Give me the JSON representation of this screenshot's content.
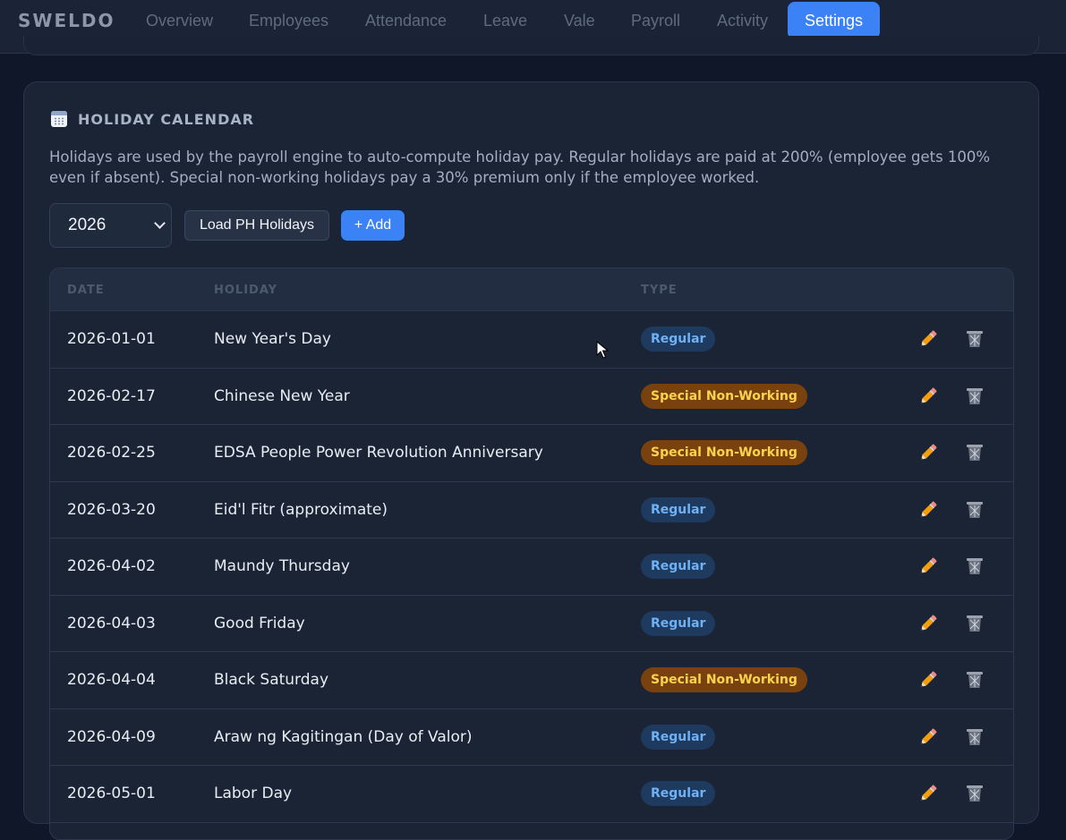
{
  "app": {
    "brand": "SWELDO"
  },
  "nav": {
    "tabs": [
      {
        "label": "Overview"
      },
      {
        "label": "Employees"
      },
      {
        "label": "Attendance"
      },
      {
        "label": "Leave"
      },
      {
        "label": "Vale"
      },
      {
        "label": "Payroll"
      },
      {
        "label": "Activity"
      },
      {
        "label": "Settings",
        "active": true
      }
    ]
  },
  "holiday_card": {
    "title": "HOLIDAY CALENDAR",
    "icon": "calendar-icon",
    "description": "Holidays are used by the payroll engine to auto-compute holiday pay. Regular holidays are paid at 200% (employee gets 100% even if absent). Special non-working holidays pay a 30% premium only if the employee worked.",
    "year_select": {
      "value": "2026"
    },
    "load_button": "Load PH Holidays",
    "add_button": "+ Add",
    "table": {
      "headers": {
        "date": "DATE",
        "holiday": "HOLIDAY",
        "type": "TYPE"
      },
      "rows": [
        {
          "date": "2026-01-01",
          "name": "New Year's Day",
          "type": "Regular"
        },
        {
          "date": "2026-02-17",
          "name": "Chinese New Year",
          "type": "Special Non-Working"
        },
        {
          "date": "2026-02-25",
          "name": "EDSA People Power Revolution Anniversary",
          "type": "Special Non-Working"
        },
        {
          "date": "2026-03-20",
          "name": "Eid'l Fitr (approximate)",
          "type": "Regular"
        },
        {
          "date": "2026-04-02",
          "name": "Maundy Thursday",
          "type": "Regular"
        },
        {
          "date": "2026-04-03",
          "name": "Good Friday",
          "type": "Regular"
        },
        {
          "date": "2026-04-04",
          "name": "Black Saturday",
          "type": "Special Non-Working"
        },
        {
          "date": "2026-04-09",
          "name": "Araw ng Kagitingan (Day of Valor)",
          "type": "Regular"
        },
        {
          "date": "2026-05-01",
          "name": "Labor Day",
          "type": "Regular"
        }
      ],
      "row_actions": {
        "edit_icon": "pencil-icon",
        "delete_icon": "trash-icon"
      }
    }
  },
  "colors": {
    "accent": "#3b82f6",
    "regular_badge_bg": "#1e3a5f",
    "regular_badge_text": "#6fb1f5",
    "special_badge_bg": "#78410e",
    "special_badge_text": "#fcd34d"
  }
}
